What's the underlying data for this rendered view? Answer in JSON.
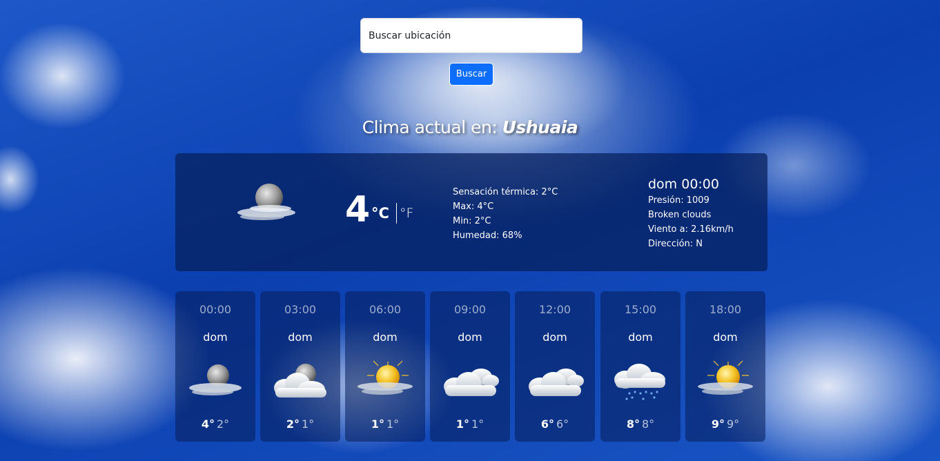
{
  "search": {
    "placeholder": "Buscar ubicación",
    "button_label": "Buscar"
  },
  "title": {
    "prefix": "Clima actual en:",
    "city": "Ushuaia"
  },
  "current": {
    "icon": "night-partly-cloudy-icon",
    "temperature": "4",
    "unit_c": "°C",
    "unit_f": "°F",
    "feels_like": "Sensación térmica: 2°C",
    "max": "Max: 4°C",
    "min": "Min: 2°C",
    "humidity": "Humedad: 68%",
    "datetime": "dom 00:00",
    "pressure": "Presión: 1009",
    "description": "Broken clouds",
    "wind": "Viento a: 2.16km/h",
    "direction": "Dirección: N"
  },
  "forecast": [
    {
      "time": "00:00",
      "day": "dom",
      "max": "4°",
      "min": "2°",
      "icon": "night-partly-cloudy-icon"
    },
    {
      "time": "03:00",
      "day": "dom",
      "max": "2°",
      "min": "1°",
      "icon": "night-cloudy-icon"
    },
    {
      "time": "06:00",
      "day": "dom",
      "max": "1°",
      "min": "1°",
      "icon": "sun-haze-icon"
    },
    {
      "time": "09:00",
      "day": "dom",
      "max": "1°",
      "min": "1°",
      "icon": "cloudy-icon"
    },
    {
      "time": "12:00",
      "day": "dom",
      "max": "6°",
      "min": "6°",
      "icon": "cloudy-icon"
    },
    {
      "time": "15:00",
      "day": "dom",
      "max": "8°",
      "min": "8°",
      "icon": "rain-cloud-icon"
    },
    {
      "time": "18:00",
      "day": "dom",
      "max": "9°",
      "min": "9°",
      "icon": "sun-haze-icon"
    }
  ],
  "colors": {
    "button": "#0d6efd",
    "card": "#061e5a"
  }
}
